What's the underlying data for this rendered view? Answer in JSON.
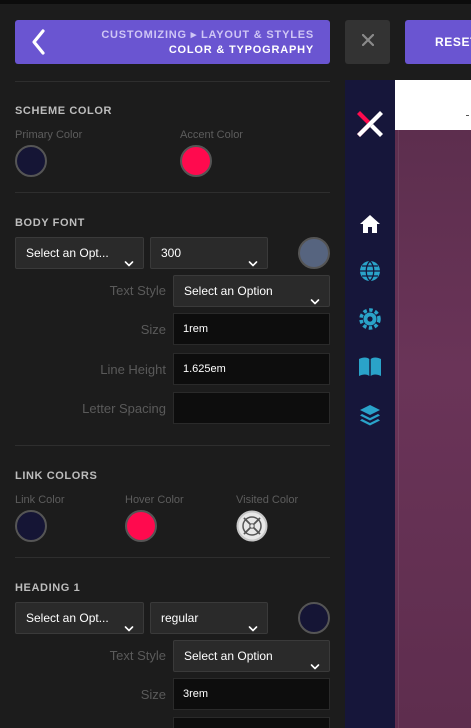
{
  "header": {
    "breadcrumb_line1": "CUSTOMIZING ▸ LAYOUT & STYLES",
    "breadcrumb_line2": "COLOR & TYPOGRAPHY",
    "close_label": "✕",
    "reset_label": "RESET"
  },
  "scheme_color": {
    "title": "SCHEME COLOR",
    "primary_label": "Primary Color",
    "primary_color": "#151535",
    "accent_label": "Accent Color",
    "accent_color": "#ff0a4e"
  },
  "body_font": {
    "title": "BODY FONT",
    "family_select": "Select an Opt...",
    "weight_select": "300",
    "font_color": "#56647f",
    "text_style_label": "Text Style",
    "text_style_select": "Select an Option",
    "size_label": "Size",
    "size_value": "1rem",
    "line_height_label": "Line Height",
    "line_height_value": "1.625em",
    "letter_spacing_label": "Letter Spacing",
    "letter_spacing_value": ""
  },
  "link_colors": {
    "title": "LINK COLORS",
    "link_label": "Link Color",
    "link_color": "#151535",
    "hover_label": "Hover Color",
    "hover_color": "#ff0a4e",
    "visited_label": "Visited Color",
    "visited_icon": "cleared-swatch-icon"
  },
  "heading1": {
    "title": "HEADING 1",
    "family_select": "Select an Opt...",
    "weight_select": "regular",
    "font_color": "#151535",
    "text_style_label": "Text Style",
    "text_style_select": "Select an Option",
    "size_label": "Size",
    "size_value": "3rem"
  },
  "preview": {
    "rail_color": "#16163a",
    "logo_colors": [
      "#ff0a4e",
      "#ffffff"
    ],
    "icons": [
      "home-icon",
      "globe-icon",
      "gear-icon",
      "book-icon",
      "layers-icon"
    ],
    "icon_color": "#2aa3c9"
  }
}
